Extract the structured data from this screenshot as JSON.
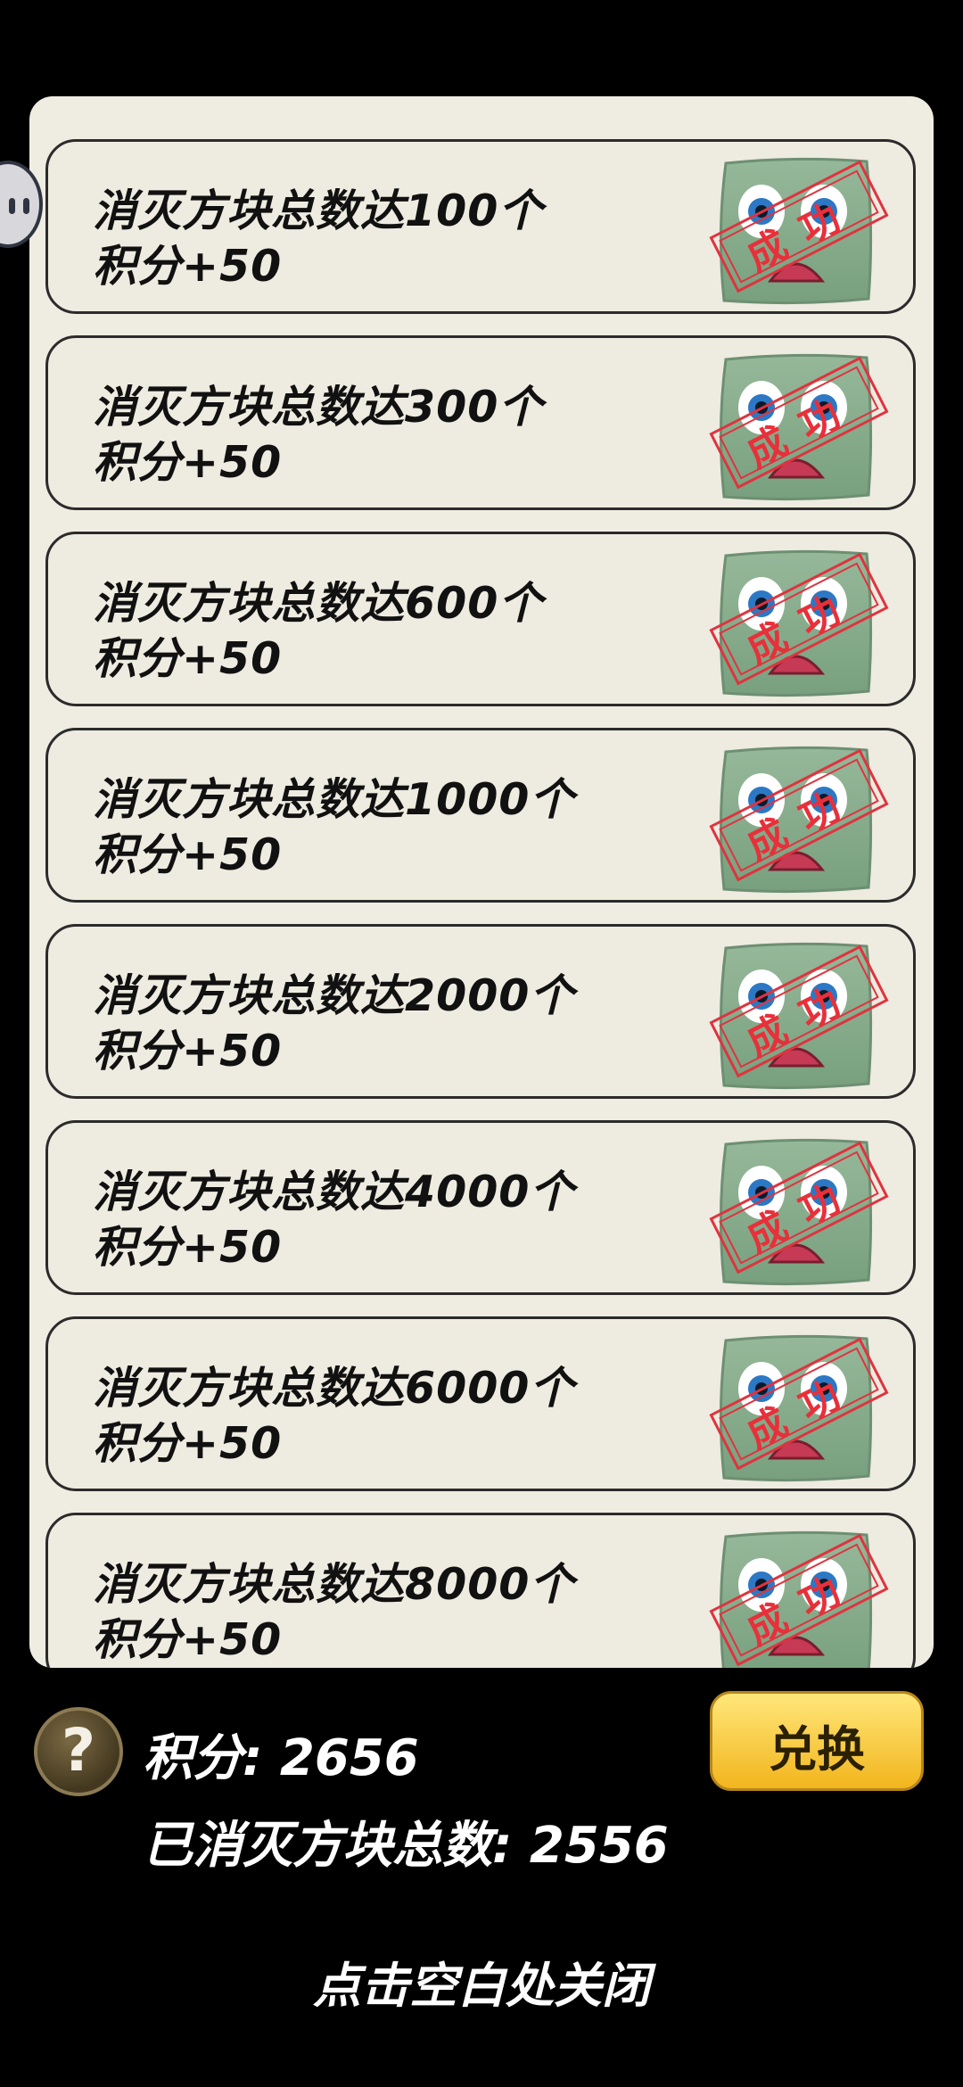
{
  "tasks": [
    {
      "title": "消灭方块总数达100个",
      "reward": "积分+50",
      "stamp": "成功"
    },
    {
      "title": "消灭方块总数达300个",
      "reward": "积分+50",
      "stamp": "成功"
    },
    {
      "title": "消灭方块总数达600个",
      "reward": "积分+50",
      "stamp": "成功"
    },
    {
      "title": "消灭方块总数达1000个",
      "reward": "积分+50",
      "stamp": "成功"
    },
    {
      "title": "消灭方块总数达2000个",
      "reward": "积分+50",
      "stamp": "成功"
    },
    {
      "title": "消灭方块总数达4000个",
      "reward": "积分+50",
      "stamp": "成功"
    },
    {
      "title": "消灭方块总数达6000个",
      "reward": "积分+50",
      "stamp": "成功"
    },
    {
      "title": "消灭方块总数达8000个",
      "reward": "积分+50",
      "stamp": "成功"
    }
  ],
  "footer": {
    "help_symbol": "?",
    "points_line": "积分: 2656",
    "destroyed_line": "已消灭方块总数: 2556",
    "exchange_label": "兑换",
    "close_hint": "点击空白处关闭"
  },
  "colors": {
    "panel": "#efece2",
    "block_green": "#86a98b",
    "stamp_red": "#e0333f",
    "button_gold": "#f2b51d"
  },
  "icons": {
    "block": "square-block-face-icon",
    "help": "question-icon",
    "side_bubble": "assistant-bubble-icon"
  }
}
